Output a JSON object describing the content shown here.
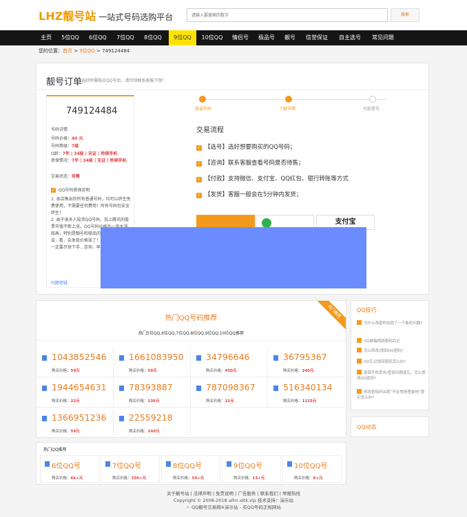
{
  "header": {
    "logo_latin": "LHZ",
    "logo_cn": "靓号站",
    "tagline": "一站式号码选购平台",
    "search_placeholder": "请输入要搜索的数字",
    "search_button": "搜索"
  },
  "nav": [
    {
      "label": "主页"
    },
    {
      "label": "5位QQ"
    },
    {
      "label": "6位QQ"
    },
    {
      "label": "7位QQ"
    },
    {
      "label": "8位QQ"
    },
    {
      "label": "9位QQ"
    },
    {
      "label": "10位QQ"
    },
    {
      "label": "情侣号"
    },
    {
      "label": "极品号"
    },
    {
      "label": "靓号"
    },
    {
      "label": "信誉保证"
    },
    {
      "label": "自主选号"
    },
    {
      "label": "常见问题"
    }
  ],
  "breadcrumb": {
    "prefix": "您的位置：",
    "home": "首页",
    "sep1": " > ",
    "cat": "9位QQ",
    "sep2": " > ",
    "current": "749124484"
  },
  "order": {
    "title": "靓号订单",
    "hint": "选好所需购买QQ号后，请尽快联系客服下单！",
    "number": "749124484",
    "details_head": "号码详情",
    "price_label": "号码价格：",
    "price_value": "40 元",
    "level_label": "号码等级：",
    "level_value": "7级",
    "q_age_label": "Q龄：",
    "q_age_value": "7年 | 34级 | 无证 | 秒绑手机",
    "credit_label": "密保情况：",
    "credit_value": "7年 | 34级 | 无证 | 秒绑手机",
    "status_label": "交易状态：",
    "status_value": "待售",
    "promise_head": "QQ号码质保说明",
    "promise_1": "1. 本店售出的所有普通号码，均可以终生免费使用，不需要任何费用！所有号码包安全终生！",
    "promise_2": "2. 由于很多人投资QQ号码，加上腾讯的股票市值不断上涨，QQ号码价格也一直水涨船高，特别是靓号和极品的QQ号，可能会...看，会发现价格涨了！我们...中的号码一定要尽快下手...咨询，早买早享受！",
    "faq_link": "问题答疑"
  },
  "steps": [
    "挑选号码",
    "了解详情",
    "付款提号"
  ],
  "flow": {
    "title": "交易流程",
    "items": [
      "【选号】选好想要购买的QQ号码；",
      "【咨询】联系客服查看号码是否待售；",
      "【付款】支持微信、支付宝、QQ红包、银行转账等方式",
      "【发货】客服一般会在5分钟内发货；"
    ]
  },
  "pay": {
    "alipay": "支付宝"
  },
  "hot": {
    "ribbon": "热门推荐",
    "title": "热门QQ号码推荐",
    "subtitle": "热门5位QQ,6位QQ,7位QQ,8位QQ,9位QQ,10位QQ推荐",
    "cards": [
      {
        "num": "1043852546",
        "label": "购买价格：",
        "price": "59元"
      },
      {
        "num": "1661083950",
        "label": "购买价格：",
        "price": "59元"
      },
      {
        "num": "34796646",
        "label": "购买价格：",
        "price": "450元"
      },
      {
        "num": "36795367",
        "label": "购买价格：",
        "price": "240元"
      },
      {
        "num": "1944654631",
        "label": "购买价格：",
        "price": "22元"
      },
      {
        "num": "78393887",
        "label": "购买价格：",
        "price": "136元"
      },
      {
        "num": "787098367",
        "label": "购买价格：",
        "price": "21元"
      },
      {
        "num": "516340134",
        "label": "购买价格：",
        "price": "1125元"
      },
      {
        "num": "1366951236",
        "label": "购买价格：",
        "price": "59元"
      },
      {
        "num": "22559218",
        "label": "购买价格：",
        "price": "240元"
      }
    ]
  },
  "side": {
    "title": "QQ技巧",
    "items": [
      "为什么改密时出现了一个新的问题?",
      "QQ邮箱找回密码后记",
      "怎么修改/找回QQ密码?",
      "QQ忘记找回密码怎么办?",
      "密保手机丢失/密保问题遗忘，怎么修改QQ密码?",
      "修改密码时出现“不在常用登录地”提示怎么办?"
    ],
    "news_title": "QQ动态"
  },
  "rec": {
    "title": "热门QQ推荐",
    "cards": [
      {
        "name": "6位QQ号",
        "label": "购买价格：",
        "price": "6k+元"
      },
      {
        "name": "7位QQ号",
        "label": "购买价格：",
        "price": "350+元"
      },
      {
        "name": "8位QQ号",
        "label": "购买价格：",
        "price": "50+元"
      },
      {
        "name": "9位QQ号",
        "label": "购买价格：",
        "price": "13+元"
      },
      {
        "name": "10位QQ号",
        "label": "购买价格：",
        "price": "8+元"
      }
    ]
  },
  "footer": {
    "links": "关于靓号站 | 法律声明 | 免责说明 | 广告服务 | 联系我们 | 举报热线",
    "copyright": "Copyright © 2008-2018 aihn.aitk.vip 技术支持：演示站",
    "slogan": "☆ QQ靓号交易网※演示站 - 买QQ号码正规网站"
  }
}
